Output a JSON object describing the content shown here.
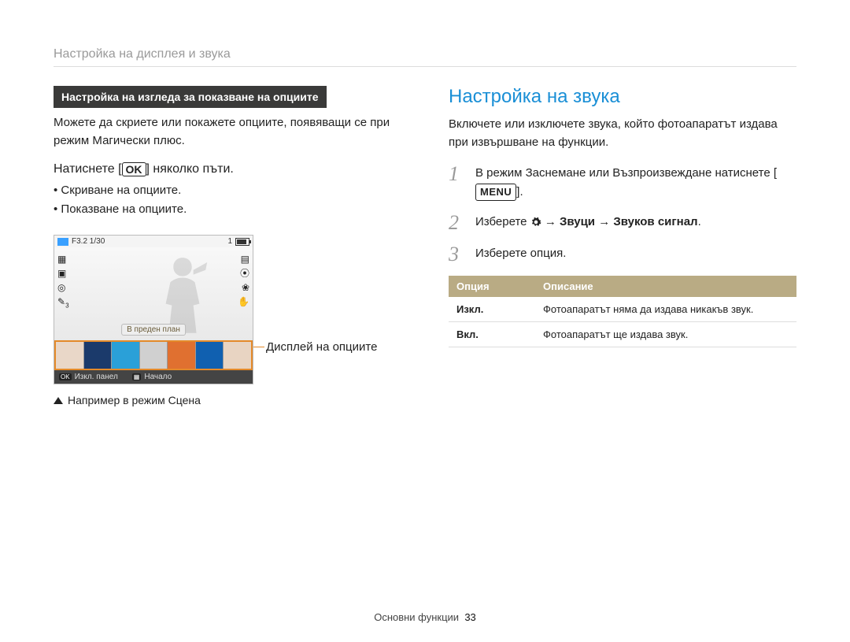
{
  "breadcrumb": "Настройка на дисплея и звука",
  "left": {
    "section_title": "Настройка на изгледа за показване на опциите",
    "intro": "Можете да скриете или покажете опциите, появяващи се при режим Магически плюс.",
    "press_prefix": "Натиснете [",
    "ok_label": "OK",
    "press_suffix": "] няколко пъти.",
    "bullets": [
      "Скриване на опциите.",
      "Показване на опциите."
    ],
    "cam": {
      "aperture": "F3.2 1/30",
      "count": "1",
      "chip": "В преден план",
      "bottom_left_key": "OK",
      "bottom_left": "Изкл. панел",
      "bottom_right_key": "▦",
      "bottom_right": "Начало",
      "thumb_colors": [
        "#e9d7c8",
        "#1b3a6b",
        "#2aa0d8",
        "#d0d0d0",
        "#e07030",
        "#1060b0",
        "#e8d4c2"
      ]
    },
    "callout": "Дисплей на опциите",
    "caption": "Например в режим Сцена"
  },
  "right": {
    "heading": "Настройка на звука",
    "intro": "Включете или изключете звука, който фотоапаратът издава при извършване на функции.",
    "steps": [
      {
        "n": "1",
        "text_a": "В режим Заснемане или Възпроизвеждане натиснете [",
        "menu_label": "MENU",
        "text_b": "]."
      },
      {
        "n": "2",
        "select": "Изберете ",
        "arrow1": " → ",
        "b1": "Звуци",
        "arrow2": " → ",
        "b2": "Звуков сигнал",
        "end": "."
      },
      {
        "n": "3",
        "text": "Изберете опция."
      }
    ],
    "table": {
      "h1": "Опция",
      "h2": "Описание",
      "rows": [
        {
          "opt": "Изкл.",
          "desc": "Фотоапаратът няма да издава никакъв звук."
        },
        {
          "opt": "Вкл.",
          "desc": "Фотоапаратът ще издава звук."
        }
      ]
    }
  },
  "footer": {
    "section": "Основни функции",
    "page": "33"
  }
}
